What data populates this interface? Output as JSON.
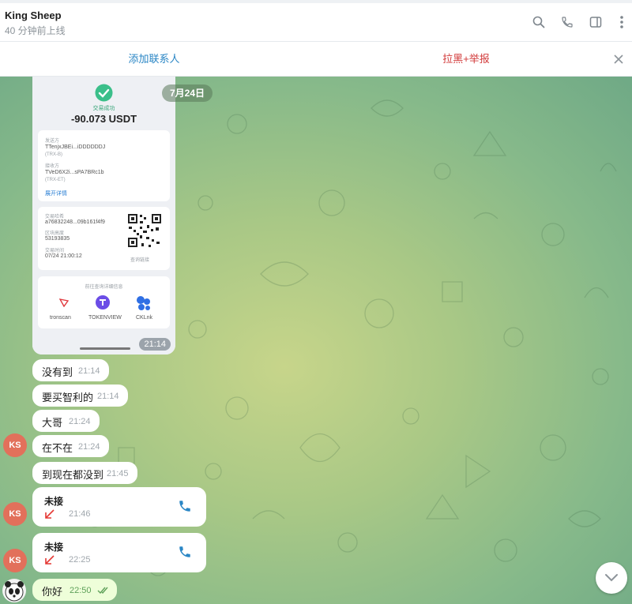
{
  "header": {
    "title": "King Sheep",
    "status": "40 分钟前上线",
    "icons": [
      "search-icon",
      "phone-icon",
      "sidebar-toggle-icon",
      "more-vertical-icon"
    ]
  },
  "actionbar": {
    "add_contact": "添加联系人",
    "block_report": "拉黑+举报",
    "close_icon": "close-icon"
  },
  "chat": {
    "date_pill": "7月24日",
    "image_message": {
      "success_label": "交易成功",
      "amount": "-90.073 USDT",
      "from_label": "发送方",
      "from_address": "TTenjxJBEi...iDDDDDDJ",
      "from_tag": "(TRX-B)",
      "to_label": "接收方",
      "to_address": "TVeD6X2i...sPA7BRc1b",
      "to_tag": "(TRX-ET)",
      "expand_details": "展开详情",
      "hash_label": "交易哈希",
      "hash_value": "a76832248...09b161f4f9",
      "block_label": "区块高度",
      "block_value": "53193835",
      "time_label": "交易时间",
      "time_value": "07/24 21:00:12",
      "query_link": "查询链接",
      "explorers_label": "前往查询详细信息",
      "explorers": [
        "tronscan",
        "TOKENVIEW",
        "CKLnk"
      ],
      "time": "21:14"
    },
    "messages": [
      {
        "text": "没有到",
        "time": "21:14"
      },
      {
        "text": "要买智利的",
        "time": "21:14"
      },
      {
        "text": "大哥",
        "time": "21:24"
      },
      {
        "text": "在不在",
        "time": "21:24",
        "avatar": "KS"
      },
      {
        "text": "到现在都没到",
        "time": "21:45"
      }
    ],
    "calls": [
      {
        "title": "未接",
        "time": "21:46",
        "avatar": "KS"
      },
      {
        "title": "未接",
        "time": "22:25",
        "avatar": "KS"
      }
    ],
    "outgoing": {
      "text": "你好",
      "time": "22:50"
    }
  },
  "colors": {
    "link_blue": "#2a86c5",
    "danger_red": "#d23a3a",
    "avatar": "#e2705b",
    "missed_call": "#e53935",
    "outgoing_bubble": "#eefed9"
  }
}
